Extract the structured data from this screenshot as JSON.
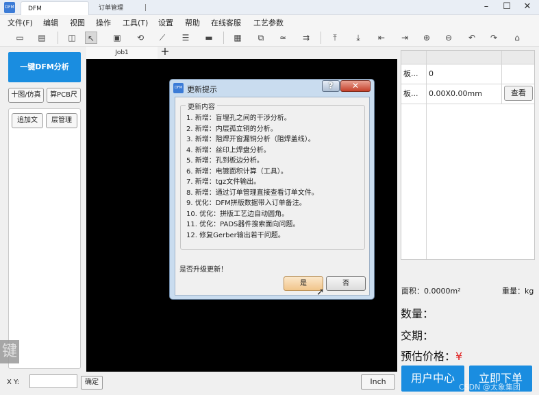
{
  "window": {
    "app_icon": "DFM",
    "tabs": [
      {
        "label": "DFM",
        "active": true
      },
      {
        "label": "订单管理",
        "active": false
      }
    ],
    "controls": [
      "minimize-icon",
      "maximize-icon",
      "close-icon"
    ]
  },
  "menu": [
    "文件(F)",
    "编辑",
    "视图",
    "操作",
    "工具(T)",
    "设置",
    "帮助",
    "在线客服",
    "工艺参数"
  ],
  "toolbar_icons": [
    "open-icon",
    "save-icon",
    "window-icon",
    "select-icon",
    "zoom-box-icon",
    "rotate-icon",
    "measure-icon",
    "filter-icon",
    "line-icon",
    "grid-icon",
    "layers-icon",
    "trace-icon",
    "route-icon",
    "upload-icon",
    "download-icon",
    "align-left-icon",
    "align-right-icon",
    "zoom-in-icon",
    "zoom-out-icon",
    "undo-icon",
    "redo-icon",
    "home-icon"
  ],
  "left": {
    "analyze_button": "一键DFM分析",
    "btn_row1": [
      "十图/仿真",
      "算PCB尺"
    ],
    "btn_row2": [
      "追加文",
      "层管理"
    ]
  },
  "canvas": {
    "job_tab": "Job1",
    "add_tab": "+",
    "background": "#000000"
  },
  "right": {
    "rows": [
      {
        "name": "板...",
        "value": "0"
      },
      {
        "name": "板...",
        "value": "0.00X0.00mm"
      }
    ],
    "view_button": "查看",
    "area_label": "面积：0.0000m²",
    "weight_label": "重量：kg",
    "quantity_label": "数量：",
    "delivery_label": "交期：",
    "price_label": "预估价格：",
    "price_symbol": "¥",
    "user_center_button": "用户中心",
    "order_button": "立即下单"
  },
  "bottom": {
    "xy_label": "X Y:",
    "xy_value": "",
    "ok_button": "确定",
    "unit_button": "Inch",
    "edge_glyph": "键"
  },
  "dialog": {
    "title": "更新提示",
    "help_label": "?",
    "close_label": "✕",
    "section_title": "更新内容",
    "notes": [
      "1. 新增：盲埋孔之间的干涉分析。",
      "2. 新增：内层孤立铜的分析。",
      "3. 新增：阻焊开窗漏铜分析（阻焊盖线）。",
      "4. 新增：丝印上焊盘分析。",
      "5. 新增：孔到板边分析。",
      "6. 新增：电镀面积计算（工具）。",
      "7. 新增：tgz文件输出。",
      "8. 新增：通过订单管理直接查看订单文件。",
      "9. 优化：DFM拼版数据带入订单备注。",
      "10. 优化：拼版工艺边自动圆角。",
      "11. 优化：PADS器件搜索面向问题。",
      "12. 修复Gerber输出若干问题。"
    ],
    "question": "是否升级更新！",
    "yes_button": "是",
    "no_button": "否"
  },
  "watermark": "CSDN @太象集团",
  "colors": {
    "accent": "#1a8de0",
    "price": "#e02020"
  }
}
